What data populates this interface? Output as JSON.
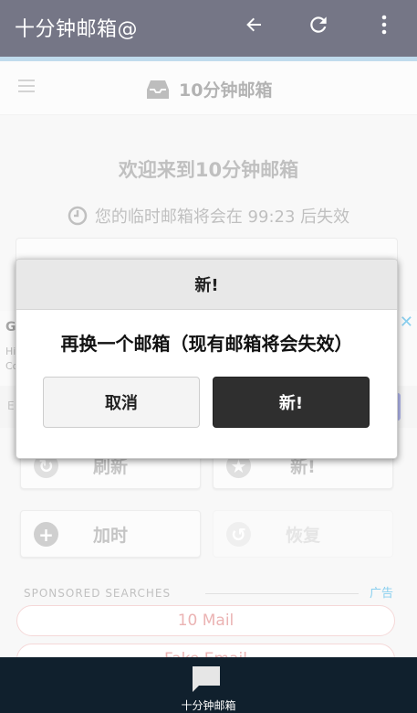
{
  "appbar": {
    "title": "十分钟邮箱@",
    "icons": [
      "back-arrow-icon",
      "refresh-icon",
      "more-vert-icon"
    ]
  },
  "header": {
    "title": "10分钟邮箱"
  },
  "main": {
    "welcome": "欢迎来到10分钟邮箱",
    "timer_text": "您的临时邮箱将会在 99:23 后失效"
  },
  "ad": {
    "g": "G",
    "line1": "Hi",
    "line2": "Co",
    "strip_text": "E"
  },
  "buttons": {
    "refresh": "刷新",
    "new": "新!",
    "extend": "加时",
    "restore": "恢复"
  },
  "sponsored": {
    "label": "SPONSORED SEARCHES",
    "ad_label": "广告",
    "items": [
      "10 Mail",
      "Fake Email"
    ]
  },
  "bottom_nav": {
    "label": "十分钟邮箱"
  },
  "dialog": {
    "title": "新!",
    "message": "再换一个邮箱（现有邮箱将会失效）",
    "cancel": "取消",
    "confirm": "新!"
  },
  "colors": {
    "appbar": "#2b2d45",
    "bottom_nav": "#10202d",
    "accent_pink": "#e08a8a",
    "ad_blue": "#4ab5e6"
  }
}
